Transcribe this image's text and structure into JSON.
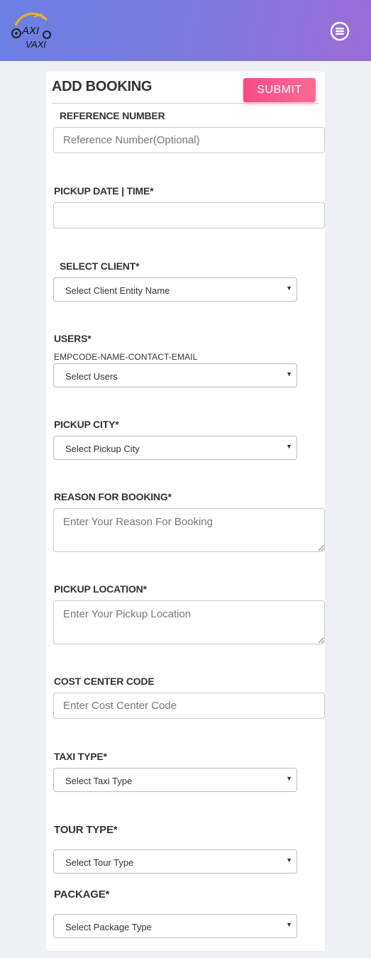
{
  "header": {
    "logo_text_top": "AXI",
    "logo_text_bottom": "VAXI",
    "brand_color_start": "#6b80e3",
    "brand_color_end": "#9a6dd6",
    "menu_icon": "hamburger-circle-icon"
  },
  "form": {
    "title": "ADD BOOKING",
    "submit_label": "SUBMIT",
    "submit_color": "#fb5a8d",
    "reference": {
      "label": "REFERENCE NUMBER",
      "placeholder": "Reference Number(Optional)"
    },
    "pickup_datetime": {
      "label": "PICKUP DATE | TIME*",
      "placeholder": ""
    },
    "client": {
      "label": "SELECT CLIENT*",
      "selected": "Select Client Entity Name"
    },
    "users": {
      "label": "USERS*",
      "sublabel": "EMPCODE-NAME-CONTACT-EMAIL",
      "selected": "Select Users"
    },
    "pickup_city": {
      "label": "PICKUP CITY*",
      "selected": "Select Pickup City"
    },
    "reason": {
      "label": "REASON FOR BOOKING*",
      "placeholder": "Enter Your Reason For Booking"
    },
    "pickup_location": {
      "label": "PICKUP LOCATION*",
      "placeholder": "Enter Your Pickup Location"
    },
    "cost_center": {
      "label": "COST CENTER CODE",
      "placeholder": "Enter Cost Center Code"
    },
    "taxi_type": {
      "label": "TAXI TYPE*",
      "selected": "Select Taxi Type"
    },
    "tour_type": {
      "label": "TOUR TYPE*",
      "selected": "Select Tour Type"
    },
    "package": {
      "label": "PACKAGE*",
      "selected": "Select Package Type"
    }
  }
}
